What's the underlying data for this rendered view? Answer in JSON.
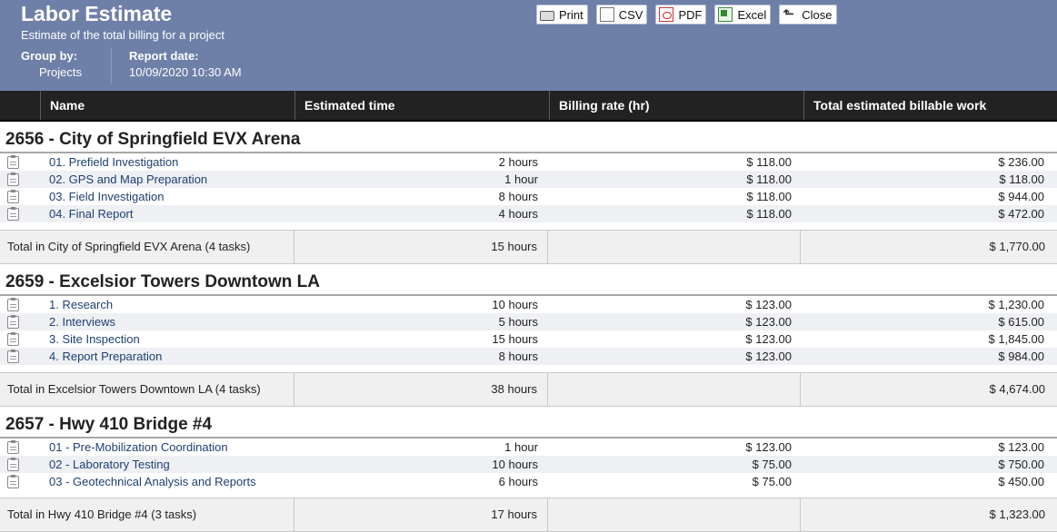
{
  "header": {
    "title": "Labor Estimate",
    "subtitle": "Estimate of the total billing for a project",
    "group_by_label": "Group by:",
    "group_by_value": "Projects",
    "report_date_label": "Report date:",
    "report_date_value": "10/09/2020 10:30 AM",
    "background_color": "#6e7fa8"
  },
  "toolbar": {
    "print": "Print",
    "csv": "CSV",
    "pdf": "PDF",
    "excel": "Excel",
    "close": "Close"
  },
  "columns": [
    "Name",
    "Estimated time",
    "Billing rate (hr)",
    "Total estimated billable work"
  ],
  "groups": [
    {
      "title": "2656 - City of Springfield EVX Arena",
      "tasks": [
        {
          "name": "01. Prefield Investigation",
          "time": "2 hours",
          "rate": "$ 118.00",
          "total": "$ 236.00",
          "icon": "clipboard-icon"
        },
        {
          "name": "02. GPS and Map Preparation",
          "time": "1 hour",
          "rate": "$ 118.00",
          "total": "$ 118.00",
          "icon": "clipboard-icon"
        },
        {
          "name": "03. Field Investigation",
          "time": "8 hours",
          "rate": "$ 118.00",
          "total": "$ 944.00",
          "icon": "clipboard-icon"
        },
        {
          "name": "04. Final Report",
          "time": "4 hours",
          "rate": "$ 118.00",
          "total": "$ 472.00",
          "icon": "clipboard-icon"
        }
      ],
      "total_label": "Total in City of Springfield EVX Arena (4 tasks)",
      "total_time": "15 hours",
      "total_amount": "$ 1,770.00"
    },
    {
      "title": "2659 - Excelsior Towers Downtown LA",
      "tasks": [
        {
          "name": "1. Research",
          "time": "10 hours",
          "rate": "$ 123.00",
          "total": "$ 1,230.00",
          "icon": "clipboard-icon"
        },
        {
          "name": "2. Interviews",
          "time": "5 hours",
          "rate": "$ 123.00",
          "total": "$ 615.00",
          "icon": "clipboard-icon"
        },
        {
          "name": "3. Site Inspection",
          "time": "15 hours",
          "rate": "$ 123.00",
          "total": "$ 1,845.00",
          "icon": "clipboard-icon"
        },
        {
          "name": "4. Report Preparation",
          "time": "8 hours",
          "rate": "$ 123.00",
          "total": "$ 984.00",
          "icon": "clipboard-icon"
        }
      ],
      "total_label": "Total in Excelsior Towers Downtown LA (4 tasks)",
      "total_time": "38 hours",
      "total_amount": "$ 4,674.00"
    },
    {
      "title": "2657 - Hwy 410 Bridge #4",
      "tasks": [
        {
          "name": "01 - Pre-Mobilization Coordination",
          "time": "1 hour",
          "rate": "$ 123.00",
          "total": "$ 123.00",
          "icon": "clipboard-icon"
        },
        {
          "name": "02 - Laboratory Testing",
          "time": "10 hours",
          "rate": "$ 75.00",
          "total": "$ 750.00",
          "icon": "clipboard-icon"
        },
        {
          "name": "03 - Geotechnical Analysis and Reports",
          "time": "6 hours",
          "rate": "$ 75.00",
          "total": "$ 450.00",
          "icon": "clipboard-icon"
        }
      ],
      "total_label": "Total in Hwy 410 Bridge #4 (3 tasks)",
      "total_time": "17 hours",
      "total_amount": "$ 1,323.00"
    }
  ]
}
